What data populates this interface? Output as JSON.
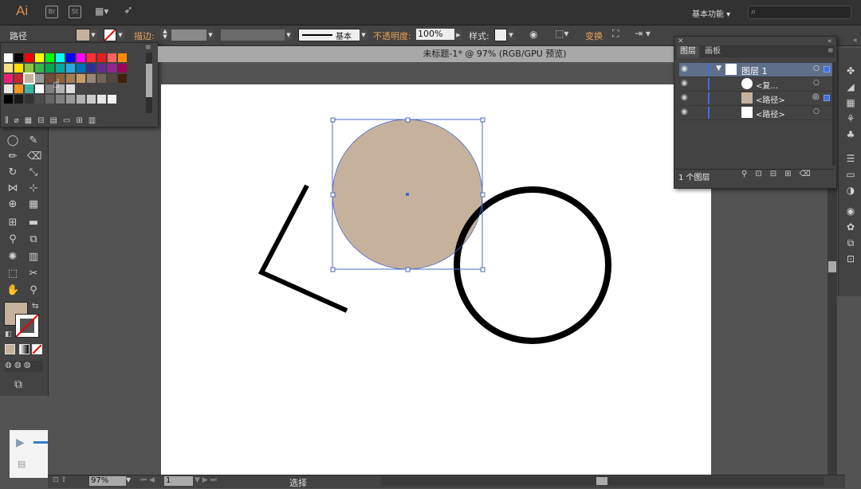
{
  "app": {
    "logo": "Ai",
    "br": "Br",
    "st": "St",
    "workspace": "基本功能 ▾"
  },
  "control_bar": {
    "selection_type": "路径",
    "stroke_label": "描边:",
    "brush_label": "基本",
    "opacity_label": "不透明度:",
    "opacity_value": "100%",
    "style_label": "样式:",
    "transform_label": "变换"
  },
  "document": {
    "tab_title": "未标题-1* @ 97% (RGB/GPU 预览)"
  },
  "status_bar": {
    "zoom": "97%",
    "artboard_num": "1",
    "tool_name": "选择"
  },
  "layers_panel": {
    "tabs": [
      "图层",
      "画板"
    ],
    "rows": [
      {
        "name": "图层 1",
        "selected": true
      },
      {
        "name": "<复...",
        "selected": false
      },
      {
        "name": "<路径>",
        "selected": false
      },
      {
        "name": "<路径>",
        "selected": false
      }
    ],
    "footer": "1 个图层"
  },
  "colors": {
    "fill": "#c6b29c",
    "accent_orange": "#e8a25b",
    "selection_blue": "#4b6ac8"
  },
  "swatches": [
    [
      "#ffffff",
      "#000000",
      "#ff0000",
      "#ffff00",
      "#00ff00",
      "#00ffff",
      "#0000ff",
      "#ff00ff",
      "#ff3030",
      "#e02020",
      "#ff6060",
      "#ff8c00"
    ],
    [
      "#f7e08a",
      "#ffe000",
      "#8cc63f",
      "#39b54a",
      "#00a651",
      "#00a99d",
      "#29abe2",
      "#0071bc",
      "#2e3192",
      "#662d91",
      "#92278f",
      "#9e005d"
    ],
    [
      "#ed1e79",
      "#c1272d",
      "#c6b29c",
      "#999999",
      "#734c32",
      "#8c6239",
      "#a67c52",
      "#c69c6d",
      "#998675",
      "#736357",
      "#534741",
      "#42210b"
    ],
    [
      "#e6e6e6",
      "#f7931e",
      "#39b5a4",
      "#ffffff",
      "#7f7f7f",
      "#b3b3b3",
      "#e0e0e0"
    ]
  ],
  "grays": [
    "#000000",
    "#1a1a1a",
    "#333333",
    "#4d4d4d",
    "#666666",
    "#808080",
    "#999999",
    "#b3b3b3",
    "#cccccc",
    "#e6e6e6",
    "#f2f2f2"
  ]
}
